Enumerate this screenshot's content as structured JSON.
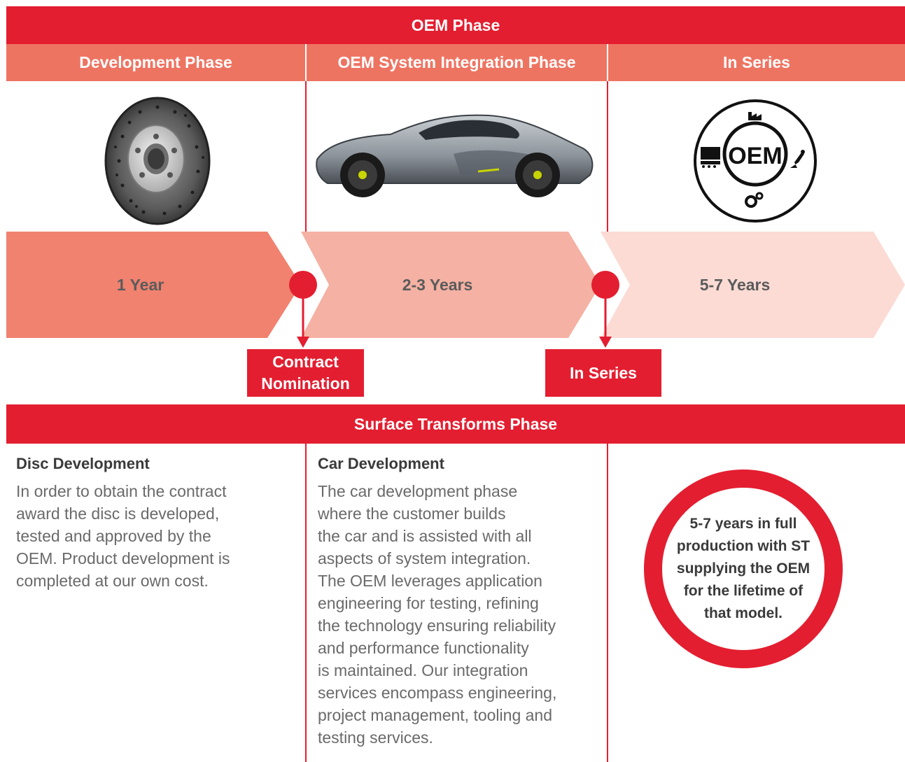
{
  "top_banner": "OEM Phase",
  "phases": [
    {
      "label": "Development Phase"
    },
    {
      "label": "OEM System Integration Phase"
    },
    {
      "label": "In Series"
    }
  ],
  "images": {
    "disc": "brake-disc-image",
    "car": "supercar-image",
    "oem_badge_text": "OEM"
  },
  "timeline": [
    {
      "label": "1 Year",
      "color": "#f0826f"
    },
    {
      "label": "2-3 Years",
      "color": "#f5b1a3"
    },
    {
      "label": "5-7 Years",
      "color": "#fbdbd4"
    }
  ],
  "milestones": [
    {
      "line1": "Contract",
      "line2": "Nomination"
    },
    {
      "line1": "In Series",
      "line2": ""
    }
  ],
  "bottom_banner": "Surface Transforms Phase",
  "columns": [
    {
      "title": "Disc Development",
      "lines": [
        "In order to obtain the contract",
        "award the disc is developed,",
        "tested and approved by the",
        "OEM. Product development is",
        "completed at our own cost."
      ]
    },
    {
      "title": "Car Development",
      "lines": [
        "The car development phase",
        "where the customer builds",
        "the car and is assisted with all",
        "aspects of system integration.",
        "The OEM leverages application",
        "engineering for testing, refining",
        "the technology ensuring reliability",
        "and performance functionality",
        "is maintained. Our integration",
        "services encompass engineering,",
        "project management, tooling and",
        "testing services."
      ]
    }
  ],
  "callout": {
    "lines": [
      "5-7 years in full",
      "production with ST",
      "supplying the OEM",
      "for the lifetime of",
      "that model."
    ]
  },
  "colors": {
    "brand_red": "#e31e30",
    "salmon": "#ee7462"
  }
}
